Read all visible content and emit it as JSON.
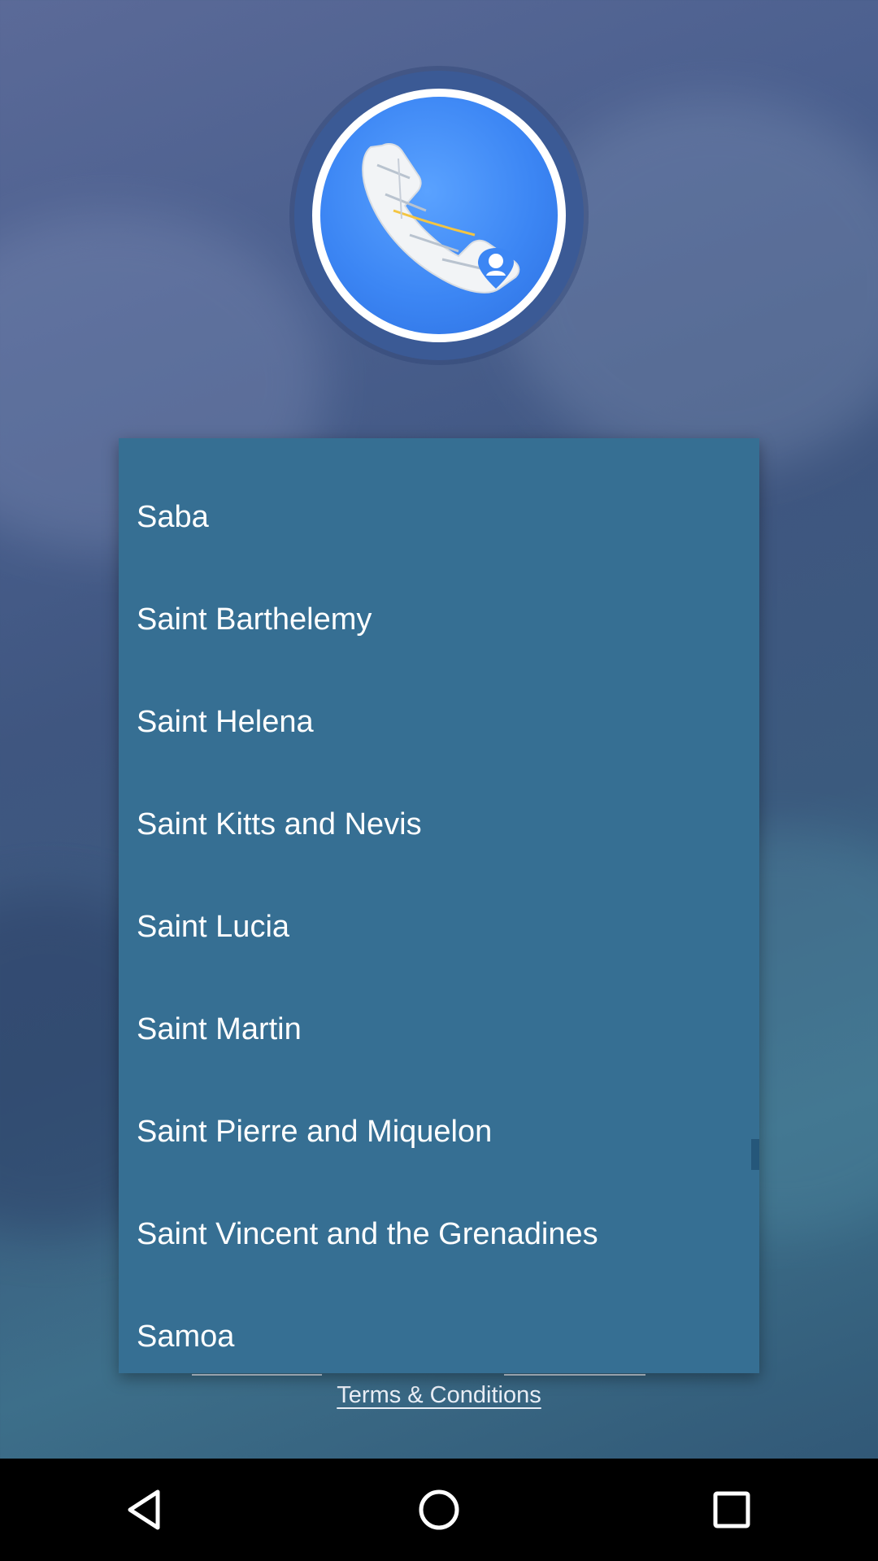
{
  "app": {
    "logo_icon": "phone-map-pin-icon"
  },
  "country_picker": {
    "items": [
      "Saba",
      "Saint Barthelemy",
      "Saint Helena",
      "Saint Kitts and Nevis",
      "Saint Lucia",
      "Saint Martin",
      "Saint Pierre and Miquelon",
      "Saint Vincent and the Grenadines",
      "Samoa"
    ],
    "background_color": "#366f93"
  },
  "footer": {
    "terms_label": "Terms & Conditions"
  },
  "nav": {
    "back_icon": "back-triangle-icon",
    "home_icon": "home-circle-icon",
    "recents_icon": "recents-square-icon"
  }
}
